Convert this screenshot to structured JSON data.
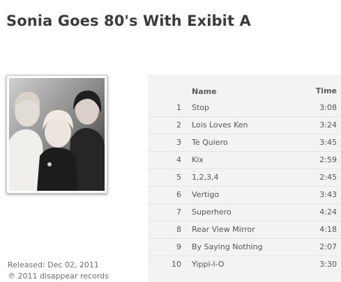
{
  "album": {
    "title": "Sonia Goes 80's With Exibit A",
    "released": "Released: Dec 02, 2011",
    "label": "℗ 2011 disappear records"
  },
  "tracklist": {
    "header_name": "Name",
    "header_time": "Time",
    "tracks": [
      {
        "number": "1",
        "name": "Stop",
        "time": "3:08"
      },
      {
        "number": "2",
        "name": "Lois Loves Ken",
        "time": "3:24"
      },
      {
        "number": "3",
        "name": "Te Quiero",
        "time": "3:45"
      },
      {
        "number": "4",
        "name": "Kix",
        "time": "2:59"
      },
      {
        "number": "5",
        "name": "1,2,3,4",
        "time": "2:45"
      },
      {
        "number": "6",
        "name": "Vertigo",
        "time": "3:43"
      },
      {
        "number": "7",
        "name": "Superhero",
        "time": "4:24"
      },
      {
        "number": "8",
        "name": "Rear View Mirror",
        "time": "4:18"
      },
      {
        "number": "9",
        "name": "By Saying Nothing",
        "time": "2:07"
      },
      {
        "number": "10",
        "name": "Yippi-I-O",
        "time": "3:30"
      }
    ]
  }
}
